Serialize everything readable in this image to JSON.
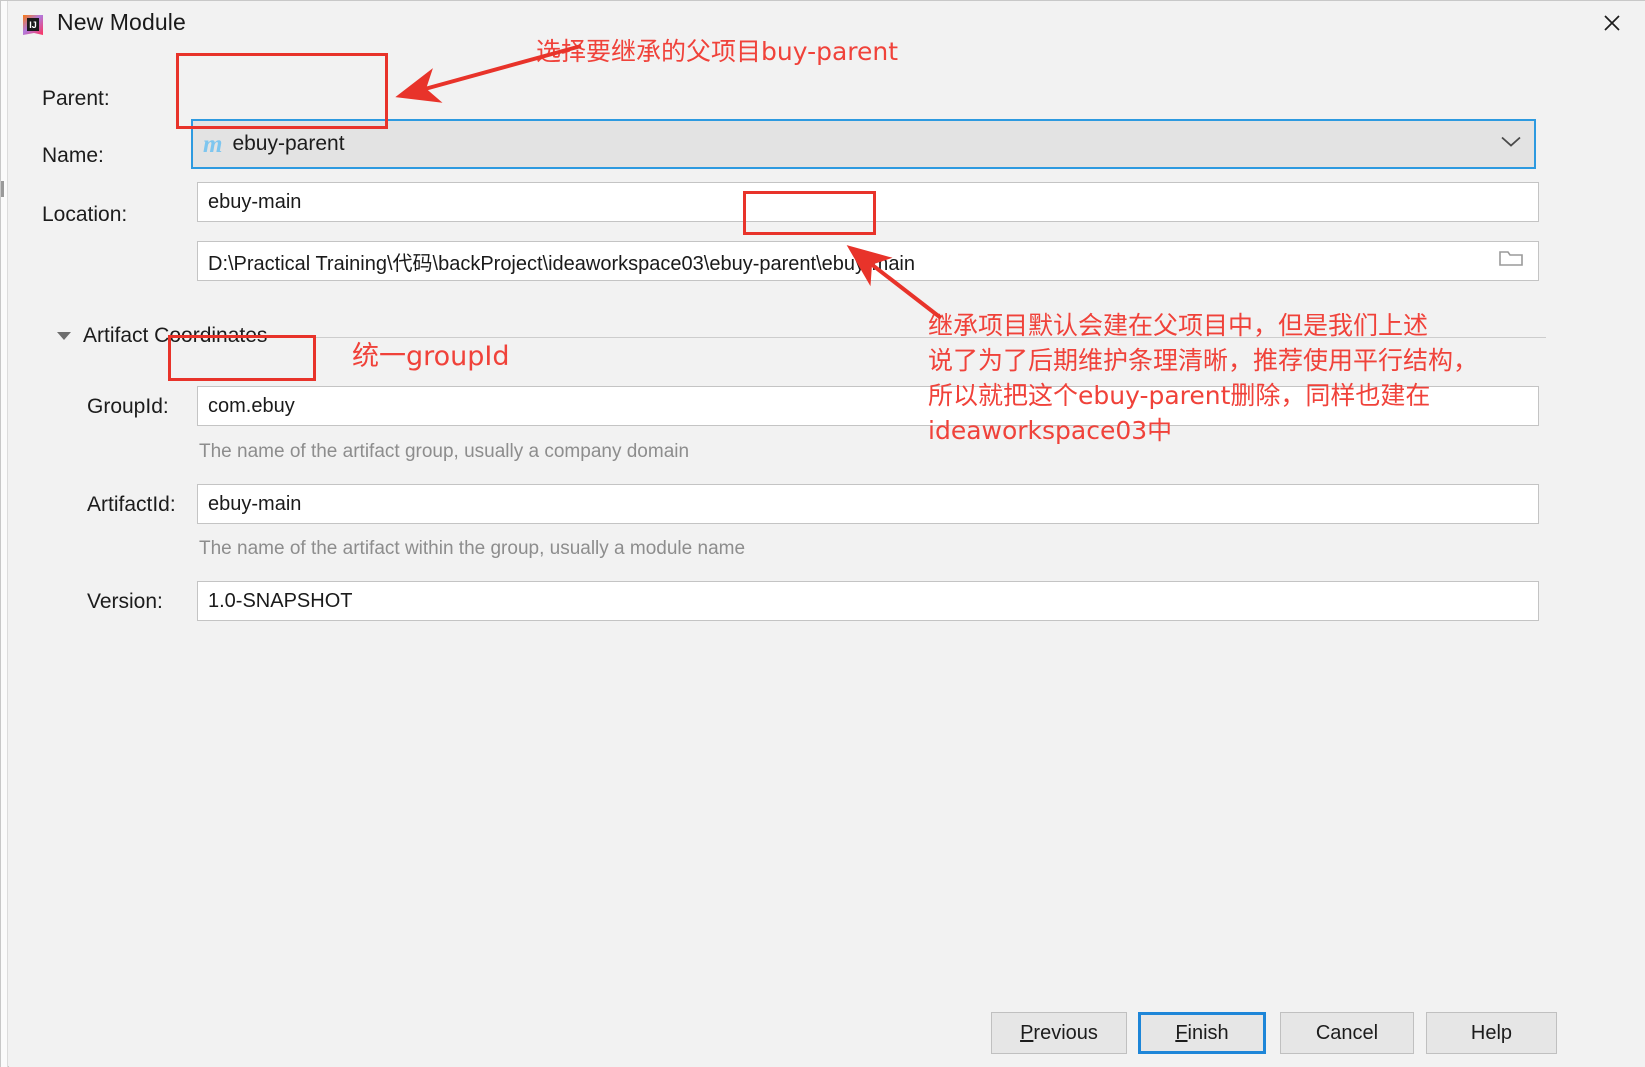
{
  "window": {
    "title": "New Module",
    "app_icon": "intellij-idea-icon",
    "close_label": "✕"
  },
  "form": {
    "parent": {
      "label": "Parent:",
      "value": "ebuy-parent",
      "icon": "maven-module-icon",
      "icon_glyph": "m",
      "chevron": "chevron-down-icon"
    },
    "name": {
      "label": "Name:",
      "value": "ebuy-main"
    },
    "location": {
      "label": "Location:",
      "value": "D:\\Practical Training\\代码\\backProject\\ideaworkspace03\\ebuy-parent\\ebuy-main",
      "browse_icon": "folder-icon"
    },
    "artifact_section": {
      "title": "Artifact Coordinates",
      "collapse_icon": "triangle-down-icon",
      "expanded": true
    },
    "group_id": {
      "label": "GroupId:",
      "value": "com.ebuy",
      "hint": "The name of the artifact group, usually a company domain"
    },
    "artifact_id": {
      "label": "ArtifactId:",
      "value": "ebuy-main",
      "hint": "The name of the artifact within the group, usually a module name"
    },
    "version": {
      "label": "Version:",
      "value": "1.0-SNAPSHOT"
    }
  },
  "buttons": {
    "previous": {
      "prefix": "",
      "mnemonic": "P",
      "suffix": "revious"
    },
    "finish": {
      "prefix": "",
      "mnemonic": "F",
      "suffix": "inish"
    },
    "cancel": {
      "prefix": "",
      "mnemonic": "",
      "suffix": "Cancel"
    },
    "help": {
      "prefix": "",
      "mnemonic": "",
      "suffix": "Help"
    }
  },
  "annotations": {
    "parent_note": "选择要继承的父项目buy-parent",
    "groupid_note": "统一groupId",
    "location_note": "继承项目默认会建在父项目中，但是我们上述\n说了为了后期维护条理清晰，推荐使用平行结构，\n所以就把这个ebuy-parent删除，同样也建在\nideaworkspace03中",
    "color": "#f0423a"
  }
}
